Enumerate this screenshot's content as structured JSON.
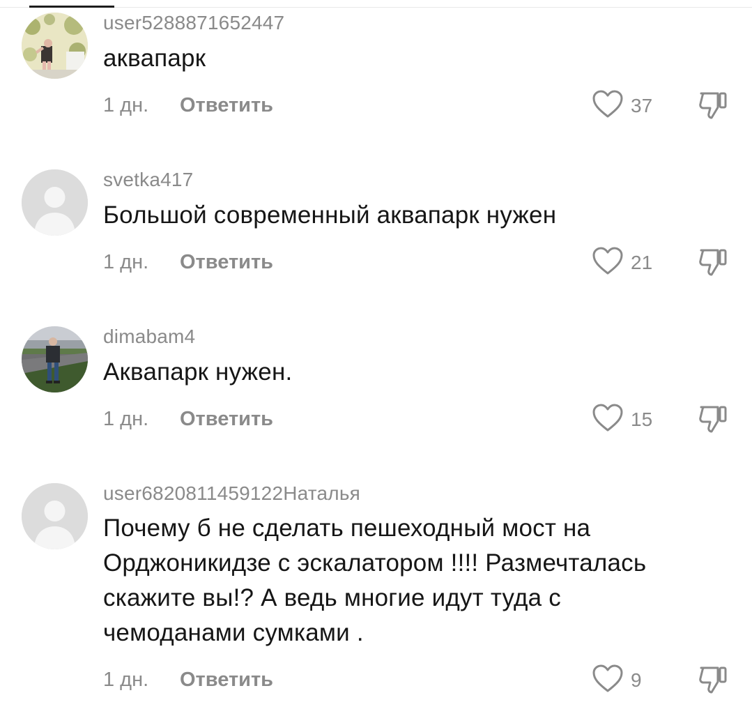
{
  "comments": [
    {
      "username": "user5288871652447",
      "text": "аквапарк",
      "time": "1 дн.",
      "reply_label": "Ответить",
      "likes": "37",
      "avatar": "photo"
    },
    {
      "username": "svetka417",
      "text": "Большой современный аквапарк нужен",
      "time": "1 дн.",
      "reply_label": "Ответить",
      "likes": "21",
      "avatar": "default"
    },
    {
      "username": "dimabam4",
      "text": "Аквапарк нужен.",
      "time": "1 дн.",
      "reply_label": "Ответить",
      "likes": "15",
      "avatar": "photo"
    },
    {
      "username": "user6820811459122Наталья",
      "text_lines": [
        "Почему б не сделать пешеходный мост на",
        "Орджоникидзе с эскалатором !!!! Размечталась",
        "скажите вы!? А ведь многие идут туда с",
        "чемоданами сумками ."
      ],
      "time": "1 дн.",
      "reply_label": "Ответить",
      "likes": "9",
      "avatar": "default"
    }
  ],
  "colors": {
    "text": "#161616",
    "muted": "#8a8a8a",
    "avatar_default_bg": "#dcdcdc"
  },
  "icons": {
    "like": "heart-outline-icon",
    "dislike": "thumbs-down-outline-icon"
  }
}
